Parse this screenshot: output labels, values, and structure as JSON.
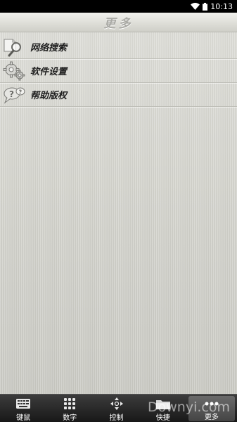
{
  "status_bar": {
    "time": "10:13",
    "icons": [
      "wifi-icon",
      "battery-icon"
    ]
  },
  "header": {
    "title": "更多"
  },
  "menu": {
    "items": [
      {
        "label": "网络搜索",
        "icon": "search-icon"
      },
      {
        "label": "软件设置",
        "icon": "gears-icon"
      },
      {
        "label": "帮助版权",
        "icon": "help-bubble-icon"
      }
    ]
  },
  "bottom_nav": {
    "items": [
      {
        "label": "键鼠",
        "icon": "keyboard-icon"
      },
      {
        "label": "数字",
        "icon": "numpad-icon"
      },
      {
        "label": "控制",
        "icon": "dpad-icon"
      },
      {
        "label": "快捷",
        "icon": "folder-icon"
      },
      {
        "label": "更多",
        "icon": "more-dots-icon"
      }
    ],
    "active": "更多"
  },
  "watermark": "Downyi.com",
  "colors": {
    "title_text": "#a9a9a4",
    "nav_bg": "#181818",
    "background": "#cfcfc8"
  }
}
